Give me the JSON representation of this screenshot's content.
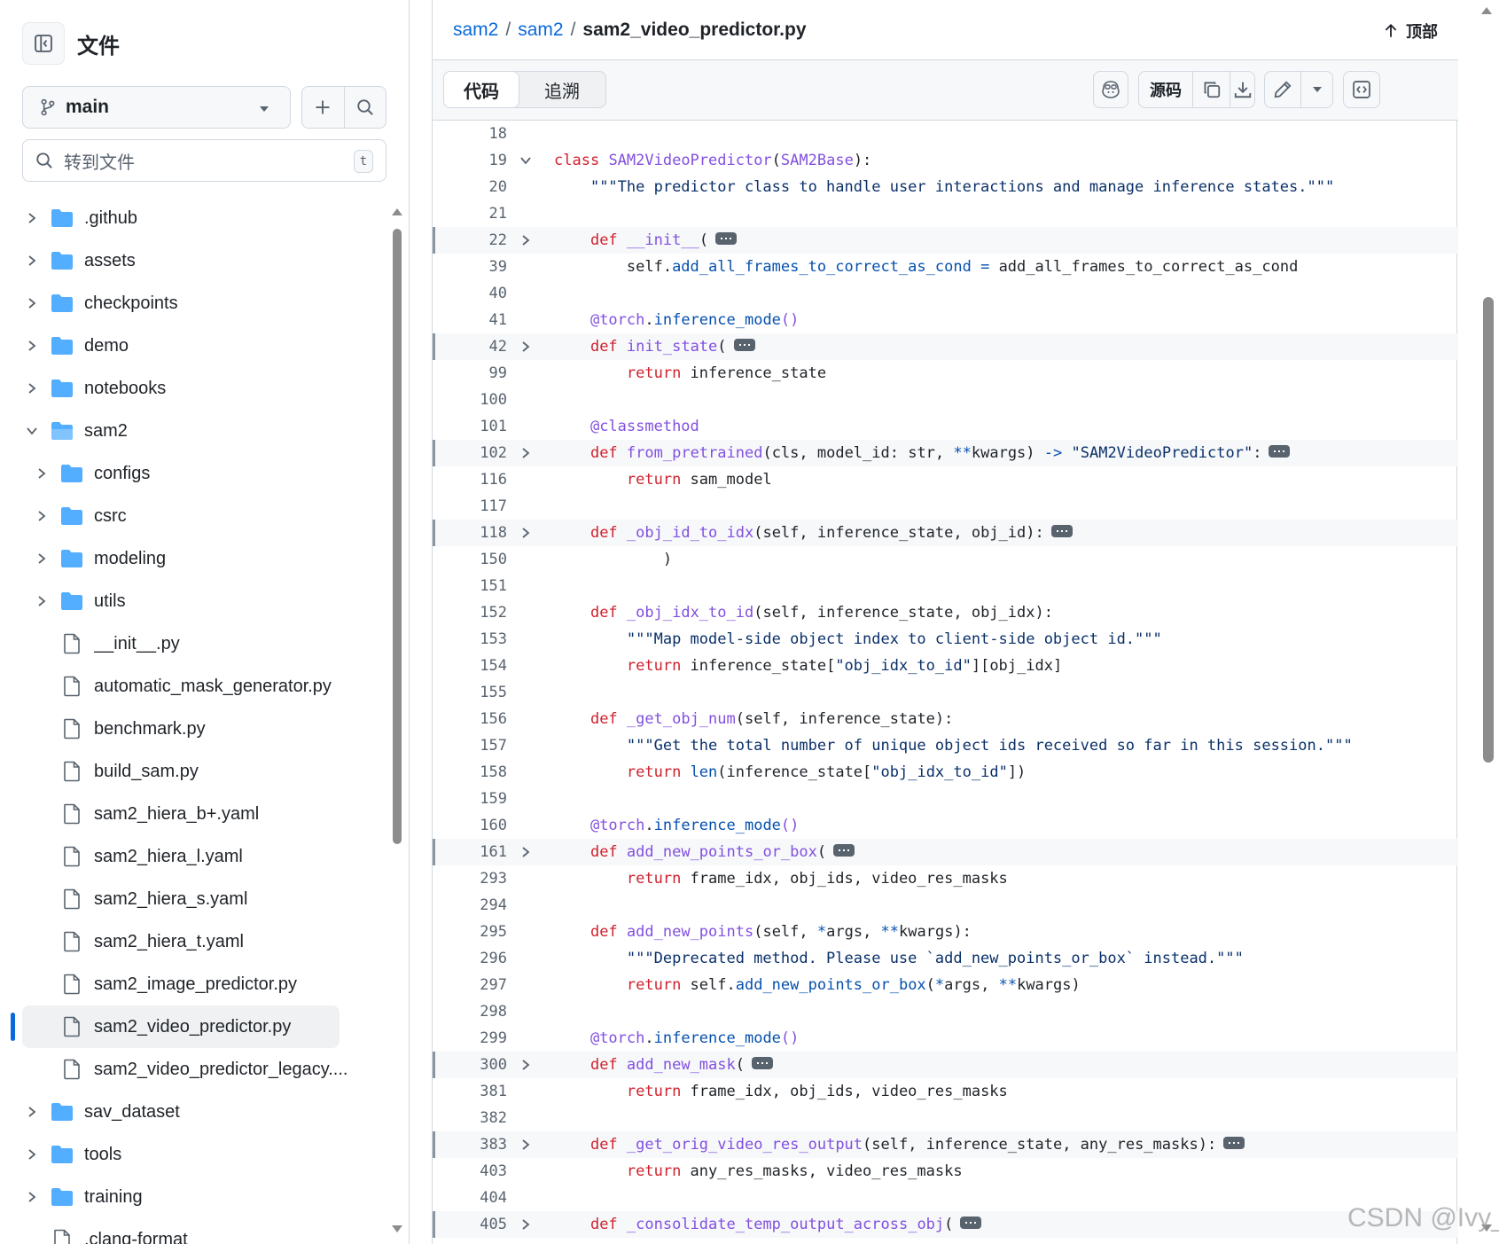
{
  "sidebar": {
    "title": "文件",
    "branch": "main",
    "goto_placeholder": "转到文件",
    "goto_shortcut": "t",
    "tree": [
      {
        "name": ".github",
        "type": "folder",
        "level": 0,
        "expanded": false
      },
      {
        "name": "assets",
        "type": "folder",
        "level": 0,
        "expanded": false
      },
      {
        "name": "checkpoints",
        "type": "folder",
        "level": 0,
        "expanded": false
      },
      {
        "name": "demo",
        "type": "folder",
        "level": 0,
        "expanded": false
      },
      {
        "name": "notebooks",
        "type": "folder",
        "level": 0,
        "expanded": false
      },
      {
        "name": "sam2",
        "type": "folder",
        "level": 0,
        "expanded": true
      },
      {
        "name": "configs",
        "type": "folder",
        "level": 1,
        "expanded": false
      },
      {
        "name": "csrc",
        "type": "folder",
        "level": 1,
        "expanded": false
      },
      {
        "name": "modeling",
        "type": "folder",
        "level": 1,
        "expanded": false
      },
      {
        "name": "utils",
        "type": "folder",
        "level": 1,
        "expanded": false
      },
      {
        "name": "__init__.py",
        "type": "file",
        "level": 1
      },
      {
        "name": "automatic_mask_generator.py",
        "type": "file",
        "level": 1
      },
      {
        "name": "benchmark.py",
        "type": "file",
        "level": 1
      },
      {
        "name": "build_sam.py",
        "type": "file",
        "level": 1
      },
      {
        "name": "sam2_hiera_b+.yaml",
        "type": "file",
        "level": 1
      },
      {
        "name": "sam2_hiera_l.yaml",
        "type": "file",
        "level": 1
      },
      {
        "name": "sam2_hiera_s.yaml",
        "type": "file",
        "level": 1
      },
      {
        "name": "sam2_hiera_t.yaml",
        "type": "file",
        "level": 1
      },
      {
        "name": "sam2_image_predictor.py",
        "type": "file",
        "level": 1
      },
      {
        "name": "sam2_video_predictor.py",
        "type": "file",
        "level": 1,
        "selected": true
      },
      {
        "name": "sam2_video_predictor_legacy....",
        "type": "file",
        "level": 1
      },
      {
        "name": "sav_dataset",
        "type": "folder",
        "level": 0,
        "expanded": false
      },
      {
        "name": "tools",
        "type": "folder",
        "level": 0,
        "expanded": false
      },
      {
        "name": "training",
        "type": "folder",
        "level": 0,
        "expanded": false
      },
      {
        "name": ".clang-format",
        "type": "file",
        "level": 0
      }
    ]
  },
  "header": {
    "crumbs": [
      "sam2",
      "sam2"
    ],
    "current_file": "sam2_video_predictor.py",
    "top_label": "顶部"
  },
  "toolbar": {
    "tab_code": "代码",
    "tab_blame": "追溯",
    "raw_label": "源码"
  },
  "code_lines": [
    {
      "n": "18",
      "html": ""
    },
    {
      "n": "19",
      "fold": "down",
      "html": "<span class='k'>class</span> <span class='f'>SAM2VideoPredictor</span>(<span class='f'>SAM2Base</span>):"
    },
    {
      "n": "20",
      "html": "    <span class='s'>\"\"\"The predictor class to handle user interactions and manage inference states.\"\"\"</span>"
    },
    {
      "n": "21",
      "html": ""
    },
    {
      "n": "22",
      "fold": "right",
      "folded": true,
      "html": "    <span class='k'>def</span> <span class='f'>__init__</span>(<span class='ellipsis'></span>"
    },
    {
      "n": "39",
      "html": "        self.<span class='v'>add_all_frames_to_correct_as_cond</span> <span class='v'>=</span> add_all_frames_to_correct_as_cond"
    },
    {
      "n": "40",
      "html": ""
    },
    {
      "n": "41",
      "html": "    <span class='f'>@torch</span>.<span class='v'>inference_mode</span><span class='f'>()</span>"
    },
    {
      "n": "42",
      "fold": "right",
      "folded": true,
      "html": "    <span class='k'>def</span> <span class='f'>init_state</span>(<span class='ellipsis'></span>"
    },
    {
      "n": "99",
      "html": "        <span class='k'>return</span> inference_state"
    },
    {
      "n": "100",
      "html": ""
    },
    {
      "n": "101",
      "html": "    <span class='f'>@classmethod</span>"
    },
    {
      "n": "102",
      "fold": "right",
      "folded": true,
      "html": "    <span class='k'>def</span> <span class='f'>from_pretrained</span>(cls, model_id: str, <span class='v'>**</span>kwargs) <span class='v'>-&gt;</span> <span class='s'>\"SAM2VideoPredictor\"</span>:<span class='ellipsis'></span>"
    },
    {
      "n": "116",
      "html": "        <span class='k'>return</span> sam_model"
    },
    {
      "n": "117",
      "html": ""
    },
    {
      "n": "118",
      "fold": "right",
      "folded": true,
      "html": "    <span class='k'>def</span> <span class='f'>_obj_id_to_idx</span>(self, inference_state, obj_id):<span class='ellipsis'></span>"
    },
    {
      "n": "150",
      "html": "            )"
    },
    {
      "n": "151",
      "html": ""
    },
    {
      "n": "152",
      "html": "    <span class='k'>def</span> <span class='f'>_obj_idx_to_id</span>(self, inference_state, obj_idx):"
    },
    {
      "n": "153",
      "html": "        <span class='s'>\"\"\"Map model-side object index to client-side object id.\"\"\"</span>"
    },
    {
      "n": "154",
      "html": "        <span class='k'>return</span> inference_state[<span class='s'>\"obj_idx_to_id\"</span>][obj_idx]"
    },
    {
      "n": "155",
      "html": ""
    },
    {
      "n": "156",
      "html": "    <span class='k'>def</span> <span class='f'>_get_obj_num</span>(self, inference_state):"
    },
    {
      "n": "157",
      "html": "        <span class='s'>\"\"\"Get the total number of unique object ids received so far in this session.\"\"\"</span>"
    },
    {
      "n": "158",
      "html": "        <span class='k'>return</span> <span class='v'>len</span>(inference_state[<span class='s'>\"obj_idx_to_id\"</span>])"
    },
    {
      "n": "159",
      "html": ""
    },
    {
      "n": "160",
      "html": "    <span class='f'>@torch</span>.<span class='v'>inference_mode</span><span class='f'>()</span>"
    },
    {
      "n": "161",
      "fold": "right",
      "folded": true,
      "html": "    <span class='k'>def</span> <span class='f'>add_new_points_or_box</span>(<span class='ellipsis'></span>"
    },
    {
      "n": "293",
      "html": "        <span class='k'>return</span> frame_idx, obj_ids, video_res_masks"
    },
    {
      "n": "294",
      "html": ""
    },
    {
      "n": "295",
      "html": "    <span class='k'>def</span> <span class='f'>add_new_points</span>(self, <span class='v'>*</span>args, <span class='v'>**</span>kwargs):"
    },
    {
      "n": "296",
      "html": "        <span class='s'>\"\"\"Deprecated method. Please use `add_new_points_or_box` instead.\"\"\"</span>"
    },
    {
      "n": "297",
      "html": "        <span class='k'>return</span> self.<span class='v'>add_new_points_or_box</span>(<span class='v'>*</span>args, <span class='v'>**</span>kwargs)"
    },
    {
      "n": "298",
      "html": ""
    },
    {
      "n": "299",
      "html": "    <span class='f'>@torch</span>.<span class='v'>inference_mode</span><span class='f'>()</span>"
    },
    {
      "n": "300",
      "fold": "right",
      "folded": true,
      "html": "    <span class='k'>def</span> <span class='f'>add_new_mask</span>(<span class='ellipsis'></span>"
    },
    {
      "n": "381",
      "html": "        <span class='k'>return</span> frame_idx, obj_ids, video_res_masks"
    },
    {
      "n": "382",
      "html": ""
    },
    {
      "n": "383",
      "fold": "right",
      "folded": true,
      "html": "    <span class='k'>def</span> <span class='f'>_get_orig_video_res_output</span>(self, inference_state, any_res_masks):<span class='ellipsis'></span>"
    },
    {
      "n": "403",
      "html": "        <span class='k'>return</span> any_res_masks, video_res_masks"
    },
    {
      "n": "404",
      "html": ""
    },
    {
      "n": "405",
      "fold": "right",
      "folded": true,
      "html": "    <span class='k'>def</span> <span class='f'>_consolidate_temp_output_across_obj</span>(<span class='ellipsis'></span>"
    }
  ],
  "watermark": "CSDN @Ivy_"
}
